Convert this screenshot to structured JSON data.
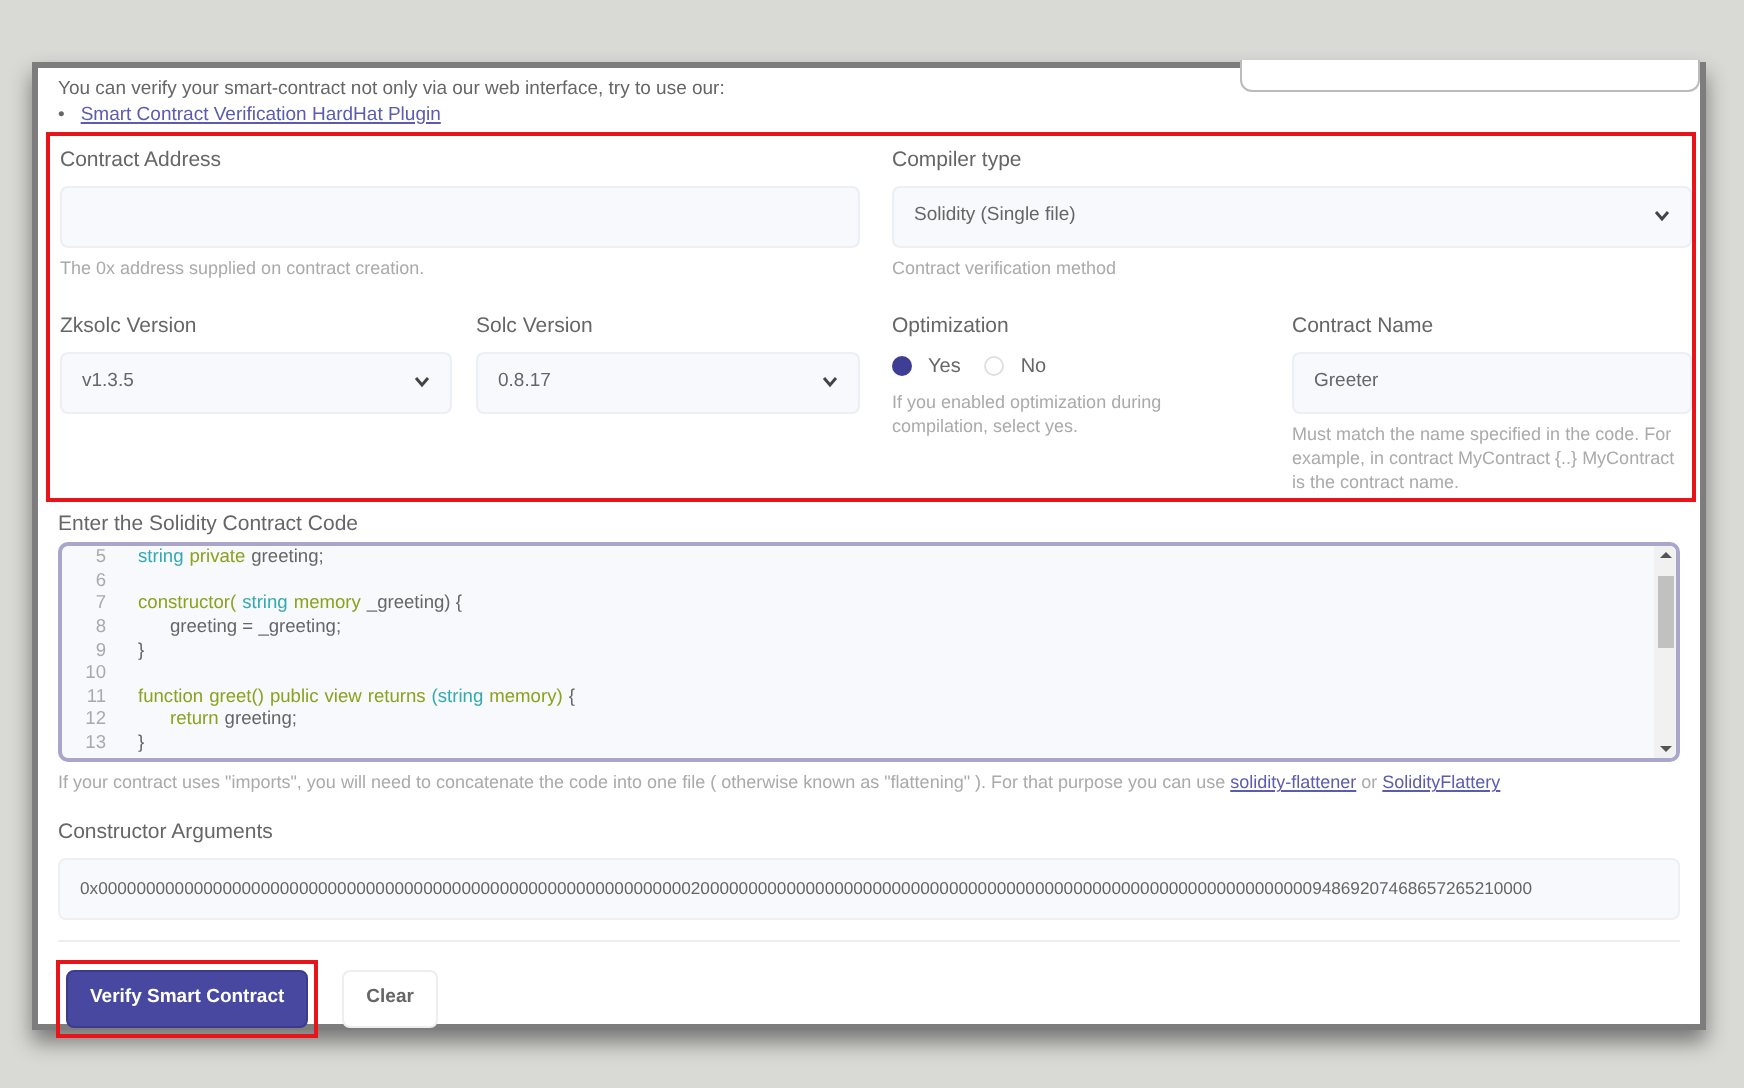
{
  "intro": {
    "bullet": "•",
    "text": "You can verify your smart-contract not only via our web interface, try to use our:",
    "link": "Smart Contract Verification HardHat Plugin"
  },
  "main_section": {
    "highlighted": true,
    "contract_address": {
      "label": "Contract Address",
      "help": "The 0x address supplied on contract creation."
    },
    "compiler_type": {
      "label": "Compiler type",
      "value": "Solidity (Single file)",
      "help": "Contract verification method"
    },
    "zksolc_version": {
      "label": "Zksolc Version",
      "value": "v1.3.5"
    },
    "solc_version": {
      "label": "Solc Version",
      "value": "0.8.17"
    },
    "optimization": {
      "label": "Optimization",
      "options": [
        {
          "label": "Yes",
          "selected": true
        },
        {
          "label": "No",
          "selected": false
        }
      ],
      "help": "If you enabled optimization during compilation, select yes."
    },
    "contract_name": {
      "label": "Contract Name",
      "value": "Greeter",
      "help": "Must match the name specified in the code. For example, in contract MyContract {..} MyContract is the contract name."
    }
  },
  "code": {
    "label": "Enter the Solidity Contract Code",
    "lines": [
      {
        "number": "5",
        "indented": false,
        "tokens": [
          {
            "kind": "type",
            "text": "string"
          },
          {
            "kind": "keyword",
            "text": "private"
          },
          {
            "kind": "plain",
            "text": "greeting;"
          }
        ]
      },
      {
        "number": "6"
      },
      {
        "number": "7",
        "indented": false,
        "tokens": [
          {
            "kind": "keyword",
            "text": "constructor("
          },
          {
            "kind": "type",
            "text": "string"
          },
          {
            "kind": "keyword",
            "text": "memory"
          },
          {
            "kind": "plain",
            "text": "_greeting) {"
          }
        ]
      },
      {
        "number": "8",
        "indented": true,
        "tokens": [
          {
            "kind": "plain",
            "text": "greeting = _greeting;"
          }
        ]
      },
      {
        "number": "9",
        "indented": false,
        "tokens": [
          {
            "kind": "plain",
            "text": "}"
          }
        ]
      },
      {
        "number": "10"
      },
      {
        "number": "11",
        "indented": false,
        "tokens": [
          {
            "kind": "keyword",
            "text": "function"
          },
          {
            "kind": "keyword",
            "text": "greet()"
          },
          {
            "kind": "keyword",
            "text": "public"
          },
          {
            "kind": "keyword",
            "text": "view"
          },
          {
            "kind": "keyword",
            "text": "returns"
          },
          {
            "kind": "type",
            "text": "(string"
          },
          {
            "kind": "keyword",
            "text": "memory)"
          },
          {
            "kind": "plain",
            "text": "{"
          }
        ]
      },
      {
        "number": "12",
        "indented": true,
        "tokens": [
          {
            "kind": "keyword",
            "text": "return"
          },
          {
            "kind": "plain",
            "text": "greeting;"
          }
        ]
      },
      {
        "number": "13",
        "indented": false,
        "tokens": [
          {
            "kind": "plain",
            "text": "}"
          }
        ]
      }
    ],
    "help": [
      {
        "kind": "text",
        "text": "If your contract uses \"imports\", you will need to concatenate the code into one file ( otherwise known as \"flattening\" ). For that purpose you can use "
      },
      {
        "kind": "link",
        "text": "solidity-flattener"
      },
      {
        "kind": "text",
        "text": " or "
      },
      {
        "kind": "link",
        "text": "SolidityFlattery"
      }
    ]
  },
  "constructor_arguments": {
    "label": "Constructor Arguments",
    "value": "0x000000000000000000000000000000000000000000000000000000000000002000000000000000000000000000000000000000000000000000000000000000094869207468657265210000"
  },
  "buttons": [
    {
      "label": "Verify Smart Contract",
      "kind": "primary",
      "highlighted": true
    },
    {
      "label": "Clear",
      "kind": "secondary",
      "highlighted": false
    }
  ]
}
